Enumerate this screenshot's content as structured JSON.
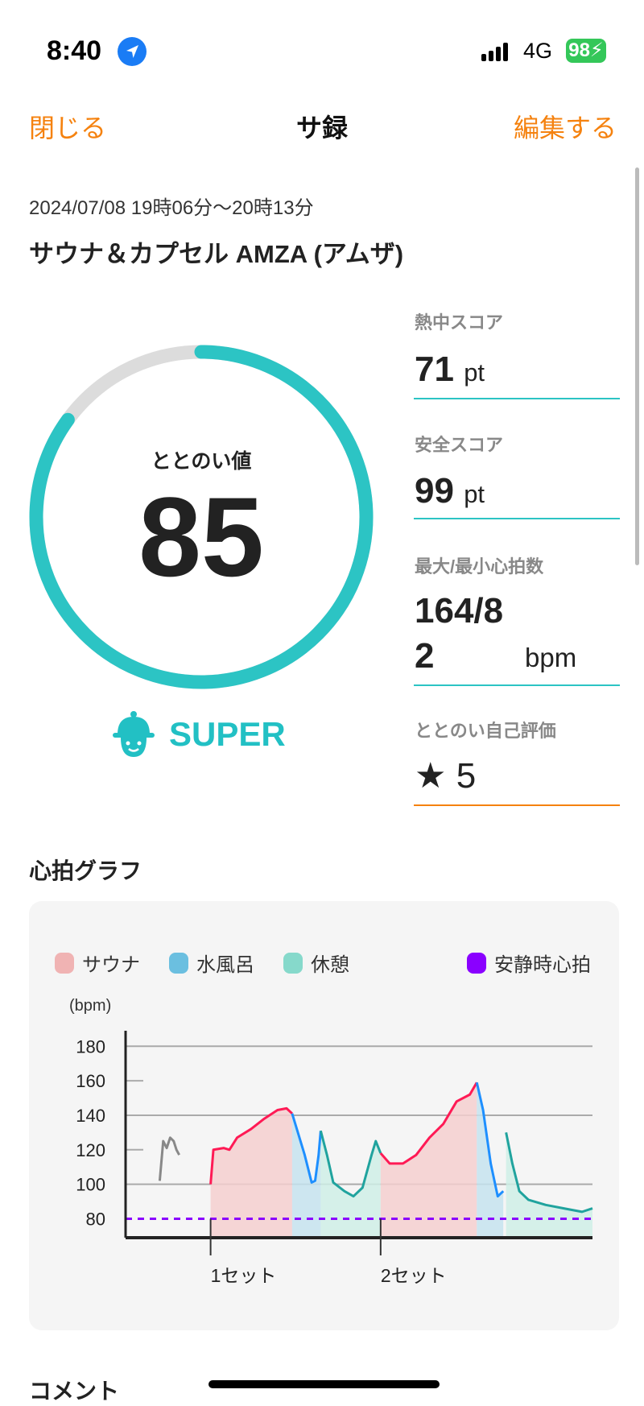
{
  "status_bar": {
    "time": "8:40",
    "network": "4G",
    "battery": "98"
  },
  "nav": {
    "close_label": "閉じる",
    "title": "サ録",
    "edit_label": "編集する"
  },
  "session": {
    "datetime": "2024/07/08 19時06分〜20時13分",
    "venue": "サウナ＆カプセル AMZA (アムザ)"
  },
  "totonoi": {
    "label": "ととのい値",
    "value": "85",
    "progress": 0.85,
    "rank": "SUPER",
    "ring_color": "#2cc4c4"
  },
  "stats": {
    "heat_label": "熱中スコア",
    "heat_value": "71",
    "heat_unit": "pt",
    "safety_label": "安全スコア",
    "safety_value": "99",
    "safety_unit": "pt",
    "hr_label": "最大/最小心拍数",
    "hr_value_line1": "164/8",
    "hr_value_line2": "2",
    "hr_unit": "bpm",
    "self_label": "ととのい自己評価",
    "self_value": "5"
  },
  "graph_title": "心拍グラフ",
  "comment_title": "コメント",
  "chart_data": {
    "type": "line",
    "legend": [
      {
        "name": "サウナ",
        "color": "#f0b3b3"
      },
      {
        "name": "水風呂",
        "color": "#6bbfe0"
      },
      {
        "name": "休憩",
        "color": "#86d9cb"
      },
      {
        "name": "安静時心拍",
        "color": "#8a00ff"
      }
    ],
    "legend_placement": "top",
    "ylabel": "(bpm)",
    "ylim": [
      69,
      189
    ],
    "yticks": [
      180,
      160,
      140,
      120,
      100,
      80
    ],
    "grid": true,
    "resting_hr": 80,
    "x_markers": [
      {
        "label": "1セット",
        "x": 12.2
      },
      {
        "label": "2セット",
        "x": 36.6
      }
    ],
    "xlim": [
      0,
      67
    ],
    "segments": [
      {
        "phase": "other",
        "color": "#888888",
        "points": [
          [
            4.9,
            102
          ],
          [
            5.4,
            125
          ],
          [
            5.9,
            121
          ],
          [
            6.4,
            127
          ],
          [
            6.9,
            125
          ],
          [
            7.3,
            120
          ],
          [
            7.7,
            117
          ]
        ]
      },
      {
        "phase": "サウナ",
        "color": "#ff1a55",
        "points": [
          [
            12.2,
            100
          ],
          [
            12.6,
            120
          ],
          [
            14.1,
            121
          ],
          [
            14.9,
            120
          ],
          [
            16.0,
            127
          ],
          [
            18.0,
            132
          ],
          [
            19.9,
            138
          ],
          [
            21.8,
            143
          ],
          [
            23.1,
            144
          ],
          [
            23.9,
            141
          ]
        ]
      },
      {
        "phase": "水風呂",
        "color": "#1e8fff",
        "points": [
          [
            23.9,
            141
          ],
          [
            25.7,
            117
          ],
          [
            26.7,
            101
          ],
          [
            27.2,
            102
          ],
          [
            27.7,
            117
          ],
          [
            28.0,
            131
          ]
        ]
      },
      {
        "phase": "休憩",
        "color": "#20a39e",
        "points": [
          [
            28.0,
            131
          ],
          [
            28.9,
            117
          ],
          [
            29.8,
            101
          ],
          [
            31.4,
            96
          ],
          [
            32.7,
            93
          ],
          [
            34.0,
            98
          ],
          [
            35.3,
            117
          ],
          [
            35.9,
            125
          ],
          [
            36.6,
            118
          ]
        ]
      },
      {
        "phase": "サウナ",
        "color": "#ff1a55",
        "points": [
          [
            36.6,
            118
          ],
          [
            37.9,
            112
          ],
          [
            39.8,
            112
          ],
          [
            41.7,
            117
          ],
          [
            43.6,
            127
          ],
          [
            45.6,
            135
          ],
          [
            47.5,
            148
          ],
          [
            49.4,
            152
          ],
          [
            50.4,
            159
          ]
        ]
      },
      {
        "phase": "水風呂",
        "color": "#1e8fff",
        "points": [
          [
            50.4,
            159
          ],
          [
            51.3,
            143
          ],
          [
            52.4,
            112
          ],
          [
            53.4,
            93
          ],
          [
            54.2,
            96
          ]
        ]
      },
      {
        "phase": "休憩",
        "color": "#20a39e",
        "points": [
          [
            54.6,
            130
          ],
          [
            55.5,
            112
          ],
          [
            56.5,
            96
          ],
          [
            57.8,
            91
          ],
          [
            60.3,
            88
          ],
          [
            62.9,
            86
          ],
          [
            65.5,
            84
          ],
          [
            67.0,
            86
          ]
        ]
      }
    ]
  }
}
